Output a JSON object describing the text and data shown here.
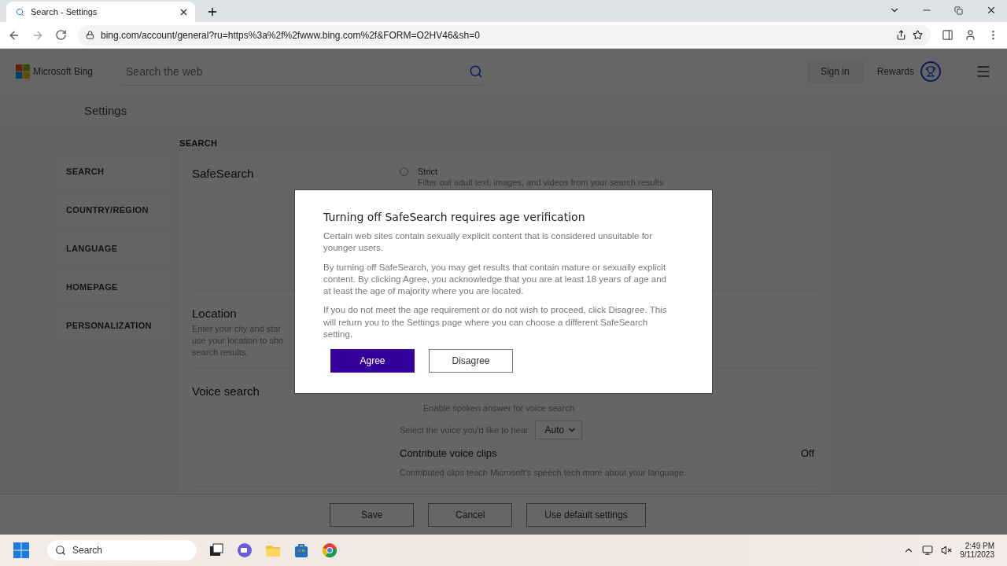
{
  "browser": {
    "tab_title": "Search - Settings",
    "url": "bing.com/account/general?ru=https%3a%2f%2fwww.bing.com%2f&FORM=O2HV46&sh=0"
  },
  "header": {
    "logo": "Microsoft Bing",
    "search_placeholder": "Search the web",
    "sign_in": "Sign in",
    "rewards": "Rewards"
  },
  "settings_title": "Settings",
  "nav": [
    "SEARCH",
    "COUNTRY/REGION",
    "LANGUAGE",
    "HOMEPAGE",
    "PERSONALIZATION"
  ],
  "section_heading": "SEARCH",
  "safesearch": {
    "title": "SafeSearch",
    "options": [
      {
        "label": "Strict",
        "description": "Filter out adult text, images, and videos from your search results",
        "selected": false
      }
    ]
  },
  "location": {
    "title": "Location",
    "description_lines": [
      "Enter your city and stat",
      "use your location to sho",
      "search results."
    ]
  },
  "voice": {
    "title": "Voice search",
    "spoken": "Enable spoken answer for voice search",
    "select_label": "Select the voice you'd like to hear",
    "select_value": "Auto",
    "clips_title": "Contribute voice clips",
    "clips_value": "Off",
    "clips_description": "Contributed clips teach Microsoft's speech tech more about your language."
  },
  "footer_buttons": [
    "Save",
    "Cancel",
    "Use default settings"
  ],
  "dialog": {
    "title": "Turning off SafeSearch requires age verification",
    "paragraphs": [
      "Certain web sites contain sexually explicit content that is considered unsuitable for younger users.",
      "By turning off SafeSearch, you may get results that contain mature or sexually explicit content. By clicking Agree, you acknowledge that you are at least 18 years of age and at least the age of majority where you are located.",
      "If you do not meet the age requirement or do not wish to proceed, click Disagree. This will return you to the Settings page where you can choose a different SafeSearch setting."
    ],
    "buttons": [
      {
        "label": "Agree",
        "kind": "primary"
      },
      {
        "label": "Disagree",
        "kind": "secondary"
      }
    ]
  },
  "taskbar": {
    "search_placeholder": "Search",
    "time": "2:49 PM",
    "date": "9/11/2023"
  }
}
